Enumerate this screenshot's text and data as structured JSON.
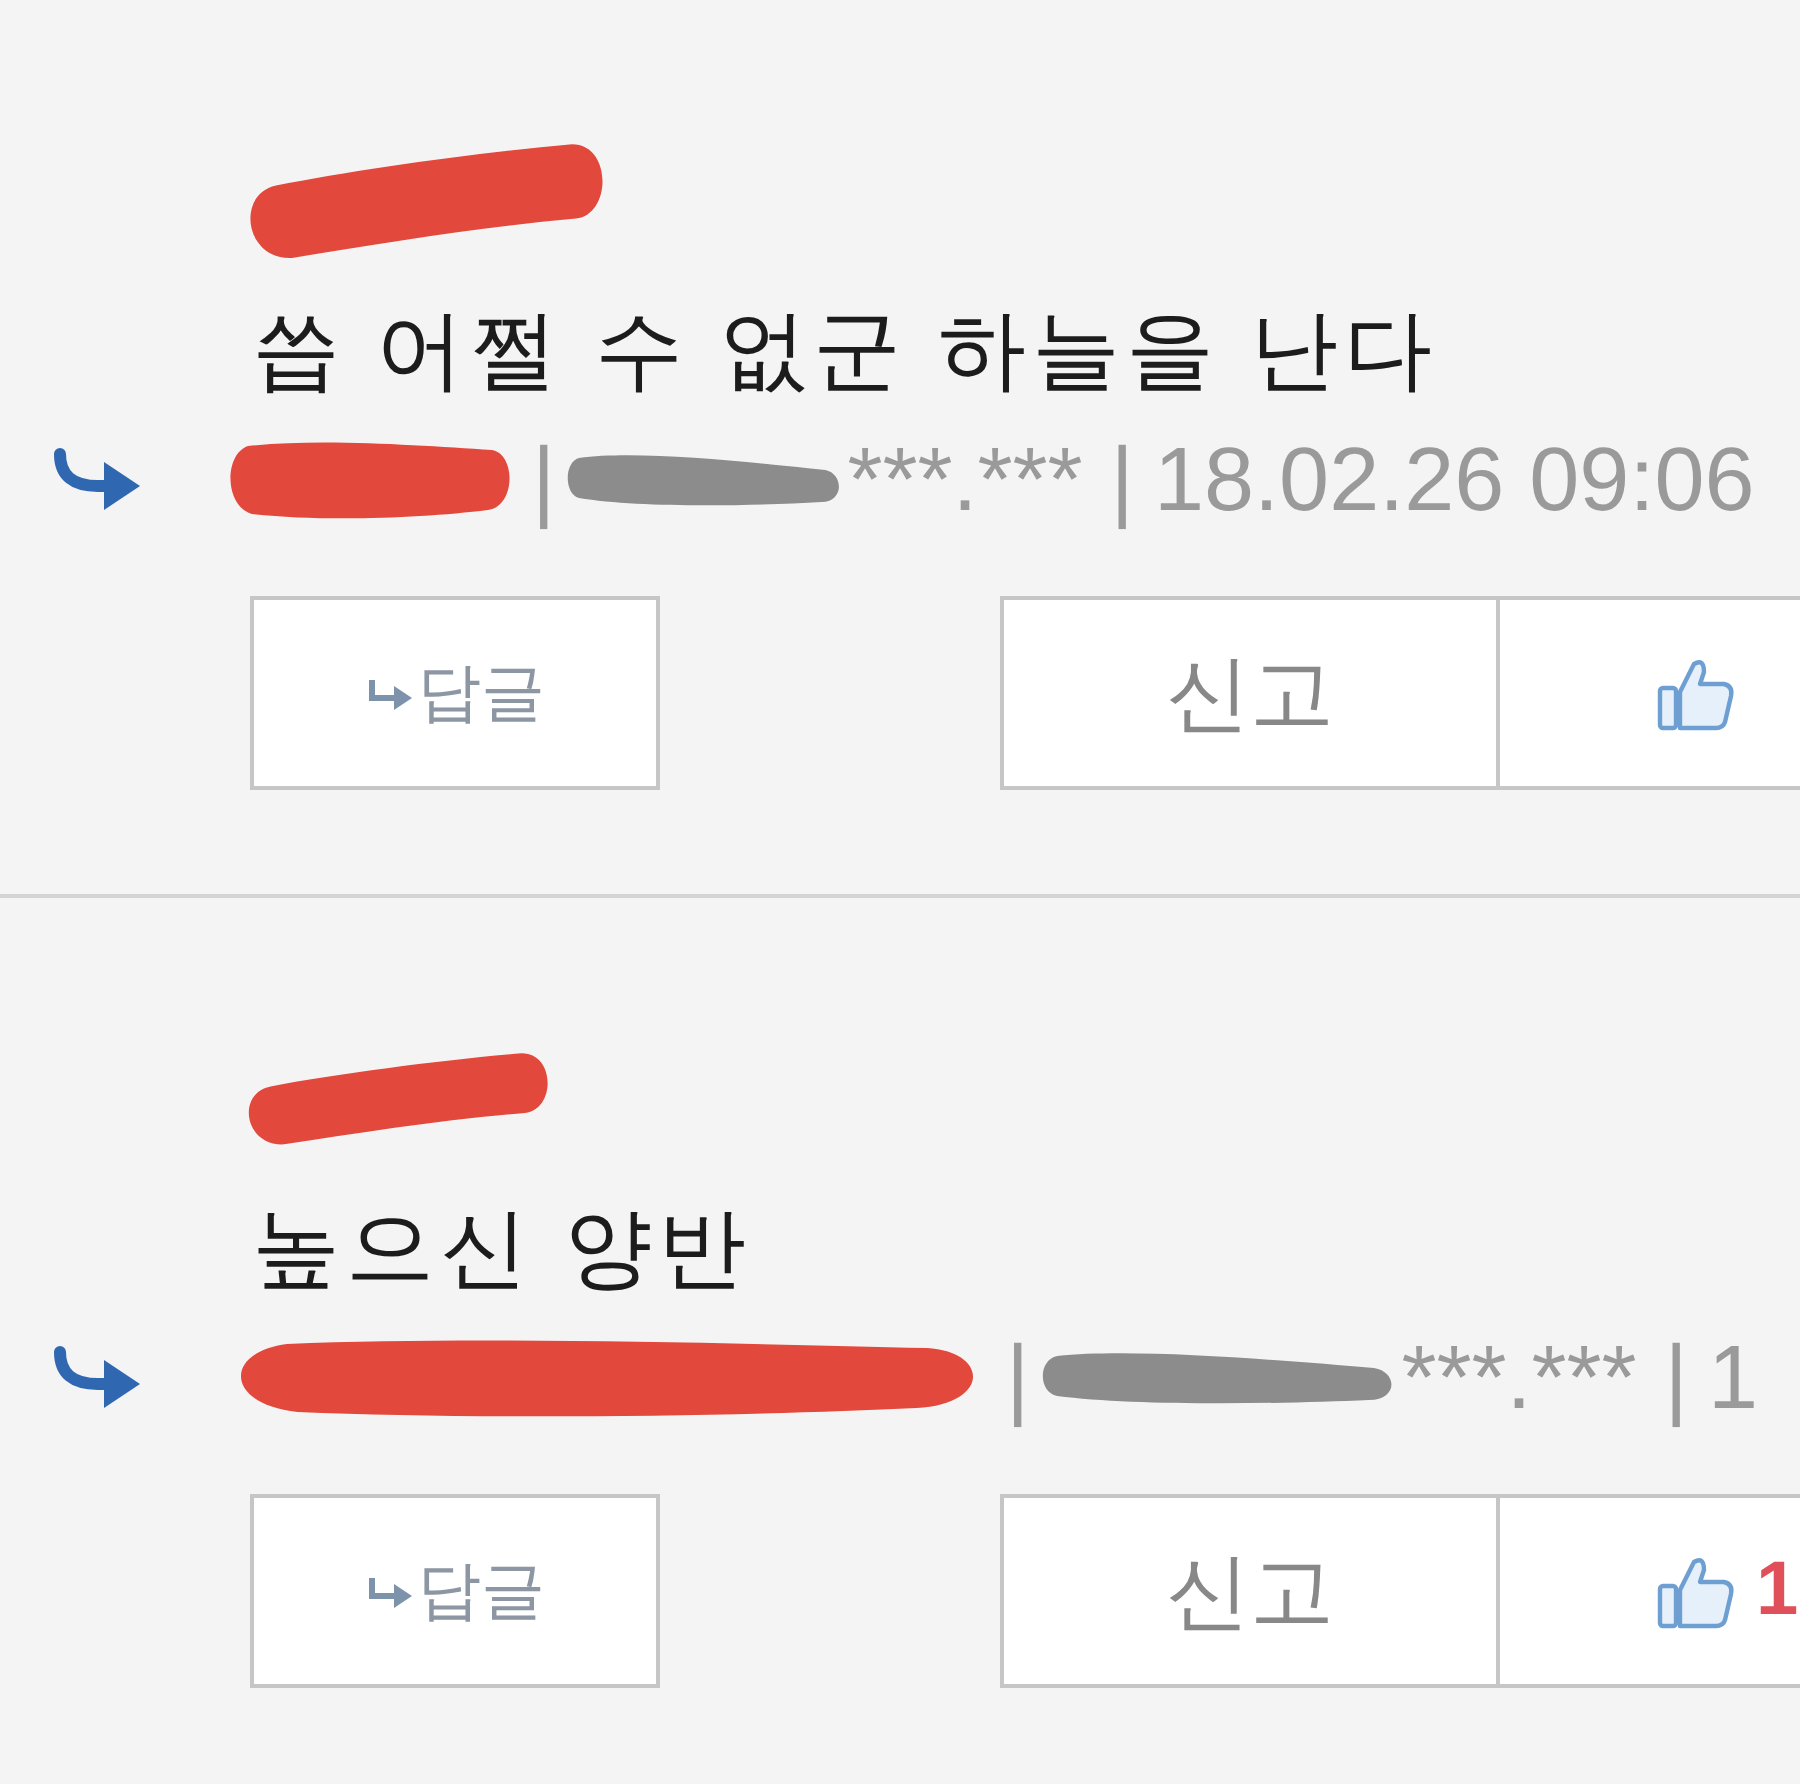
{
  "comments": [
    {
      "mention_redacted": true,
      "text": "씁 어쩔 수 없군 하늘을 난다",
      "author_redacted": true,
      "ip_partly_redacted": true,
      "divider_before_ip": "|",
      "ip": "***.***",
      "divider_before_date": "|",
      "date": "18.02.26 09:06",
      "reply_button": {
        "label": "답글"
      },
      "report_button": {
        "label": "신고"
      }
    },
    {
      "mention_redacted": true,
      "text": "높으신 양반",
      "author_redacted": true,
      "ip_partly_redacted": true,
      "divider_before_ip": "|",
      "ip": "***.***",
      "divider_before_date": "|",
      "date": "1",
      "reply_button": {
        "label": "답글"
      },
      "report_button": {
        "label": "신고"
      },
      "like_button": {
        "count": "1"
      }
    }
  ]
}
